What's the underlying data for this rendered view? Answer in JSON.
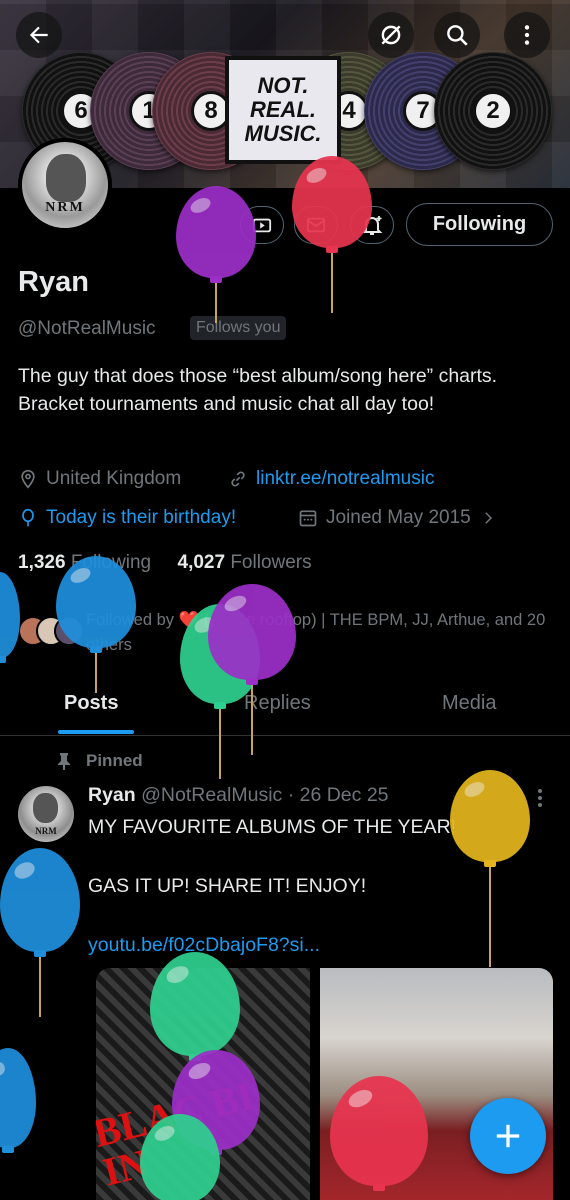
{
  "banner": {
    "record_numbers": [
      "6",
      "1",
      "8",
      "4",
      "7",
      "2"
    ],
    "logo_lines": [
      "NOT.",
      "REAL.",
      "MUSIC."
    ]
  },
  "top_bar": {
    "back_icon": "arrow-left-icon",
    "grok_icon": "grok-icon",
    "search_icon": "search-icon",
    "more_icon": "more-vertical-icon"
  },
  "avatar": {
    "monogram": "NRM"
  },
  "actions": {
    "subscribe_icon": "subscribe-icon",
    "message_icon": "mail-icon",
    "notify_icon": "bell-plus-icon",
    "follow_label": "Following"
  },
  "profile": {
    "name": "Ryan",
    "handle": "@NotRealMusic",
    "follows_you": "Follows you",
    "bio": "The guy that does those “best album/song here” charts. Bracket tournaments and music chat all day too!",
    "location": "United Kingdom",
    "website": "linktr.ee/notrealmusic",
    "birthday": "Today is their birthday!",
    "joined": "Joined May 2015",
    "following_count": "1,326",
    "following_label": "Following",
    "followers_count": "4,027",
    "followers_label": "Followers",
    "followed_by": "Followed by ❤️ (on the rooftop) | THE BPM, JJ, Arthue, and 20 others"
  },
  "tabs": [
    "Posts",
    "Replies",
    "Media"
  ],
  "pinned_post": {
    "pinned_label": "Pinned",
    "author_name": "Ryan",
    "author_handle": "@NotRealMusic",
    "date": "· 26 Dec 25",
    "line1": "MY FAVOURITE ALBUMS OF THE YEAR!",
    "line2": "GAS IT UP! SHARE IT! ENJOY!",
    "link": "youtu.be/f02cDbajoF8?si...",
    "image1_text": "BLAC BI IN"
  },
  "fab": {
    "icon": "compose-plus-icon"
  },
  "colors": {
    "accent": "#1d9bf0",
    "balloon_purple": "#9b2fc7",
    "balloon_red": "#e8344f",
    "balloon_blue": "#1f8fdc",
    "balloon_green": "#2fcf8f",
    "balloon_yellow": "#e3b51d"
  }
}
